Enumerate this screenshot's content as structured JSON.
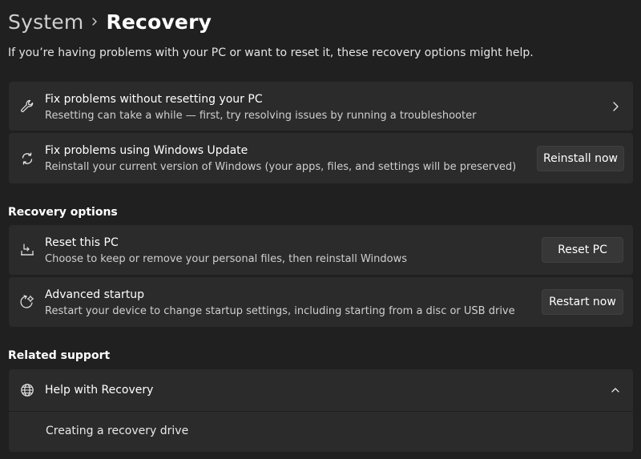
{
  "breadcrumb": {
    "parent": "System",
    "current": "Recovery"
  },
  "intro": "If you’re having problems with your PC or want to reset it, these recovery options might help.",
  "top_cards": [
    {
      "icon": "wrench-icon",
      "title": "Fix problems without resetting your PC",
      "desc": "Resetting can take a while — first, try resolving issues by running a troubleshooter"
    },
    {
      "icon": "refresh-icon",
      "title": "Fix problems using Windows Update",
      "desc": "Reinstall your current version of Windows (your apps, files, and settings will be preserved)",
      "button": "Reinstall now"
    }
  ],
  "recovery_options": {
    "heading": "Recovery options",
    "items": [
      {
        "icon": "reset-pc-icon",
        "title": "Reset this PC",
        "desc": "Choose to keep or remove your personal files, then reinstall Windows",
        "button": "Reset PC"
      },
      {
        "icon": "advanced-startup-icon",
        "title": "Advanced startup",
        "desc": "Restart your device to change startup settings, including starting from a disc or USB drive",
        "button": "Restart now"
      }
    ]
  },
  "related_support": {
    "heading": "Related support",
    "help_title": "Help with Recovery",
    "link": "Creating a recovery drive"
  },
  "colors": {
    "background": "#202020",
    "card": "#2b2b2b",
    "button": "#373737"
  }
}
